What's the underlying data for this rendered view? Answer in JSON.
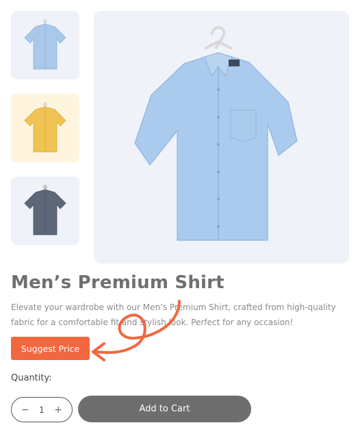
{
  "gallery": {
    "thumbnails": [
      {
        "name": "blue shirt",
        "color": "#a9c8ea",
        "bg": "#eff2f8"
      },
      {
        "name": "yellow shirt",
        "color": "#f0c454",
        "bg": "#fff5df"
      },
      {
        "name": "gray shirt",
        "color": "#5d6778",
        "bg": "#eff2f8"
      }
    ],
    "main_color": "#aacbed"
  },
  "product": {
    "title": "Men’s Premium Shirt",
    "description": "Elevate your wardrobe with our Men’s Premium Shirt, crafted from high-quality fabric for a comfortable fit and stylish look. Perfect for any occasion!",
    "suggest_price_label": "Suggest Price",
    "quantity_label": "Quantity:",
    "quantity_value": "1",
    "minus_symbol": "−",
    "plus_symbol": "+",
    "add_to_cart_label": "Add to Cart"
  },
  "colors": {
    "accent": "#f26740",
    "cart_button": "#6e6e6e",
    "annotation": "#f26740"
  }
}
